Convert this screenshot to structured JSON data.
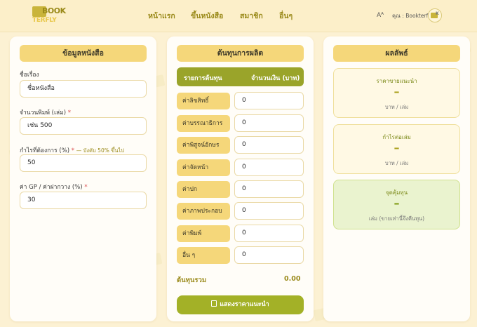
{
  "brand": {
    "logo_top": "BOOK",
    "logo_bottom": "TERFLY"
  },
  "nav": {
    "items": [
      {
        "label": "หน้าแรก"
      },
      {
        "label": "ขึ้นหนังสือ"
      },
      {
        "label": "สมาชิก"
      },
      {
        "label": "อื่นๆ"
      }
    ],
    "lang_icon": "Aᴬ",
    "user_label": "คุณ : Bookterfly",
    "avatar_letter": "K"
  },
  "book_info": {
    "header": "ข้อมูลหนังสือ",
    "title_label": "ชื่อเรื่อง",
    "title_value": "ชื่อหนังสือ",
    "print_label": "จำนวนพิมพ์ (เล่ม)",
    "print_value": "เช่น 500",
    "profit_label": "กำไรที่ต้องการ (%)",
    "profit_hint": "— บังคับ 50% ขึ้นไป",
    "profit_value": "50",
    "gp_label": "ค่า GP / ค่าฝากวาง (%)",
    "gp_value": "30",
    "required_mark": "*"
  },
  "costs": {
    "header": "ต้นทุนการผลิต",
    "col_item": "รายการต้นทุน",
    "col_amount": "จำนวนเงิน (บาท)",
    "rows": [
      {
        "label": "ค่าลิขสิทธิ์",
        "value": "0"
      },
      {
        "label": "ค่าบรรณาธิการ",
        "value": "0"
      },
      {
        "label": "ค่าพิสูจน์อักษร",
        "value": "0"
      },
      {
        "label": "ค่าจัดหน้า",
        "value": "0"
      },
      {
        "label": "ค่าปก",
        "value": "0"
      },
      {
        "label": "ค่าภาพประกอบ",
        "value": "0"
      },
      {
        "label": "ค่าพิมพ์",
        "value": "0"
      },
      {
        "label": "อื่น ๆ",
        "value": "0"
      }
    ],
    "total_label": "ต้นทุนรวม",
    "total_value": "0.00",
    "button_label": "แสดงราคาแนะนำ"
  },
  "results": {
    "header": "ผลลัพธ์",
    "cards": [
      {
        "title": "ราคาขายแนะนำ",
        "value": "–",
        "unit": "บาท / เล่ม"
      },
      {
        "title": "กำไรต่อเล่ม",
        "value": "–",
        "unit": "บาท / เล่ม"
      },
      {
        "title": "จุดคุ้มทุน",
        "value": "–",
        "unit": "เล่ม (ขายเท่านี้จึงคืนทุน)"
      }
    ]
  },
  "colors": {
    "accent": "#f5d77a",
    "olive": "#9aa42a",
    "background": "#fcf1d3"
  }
}
